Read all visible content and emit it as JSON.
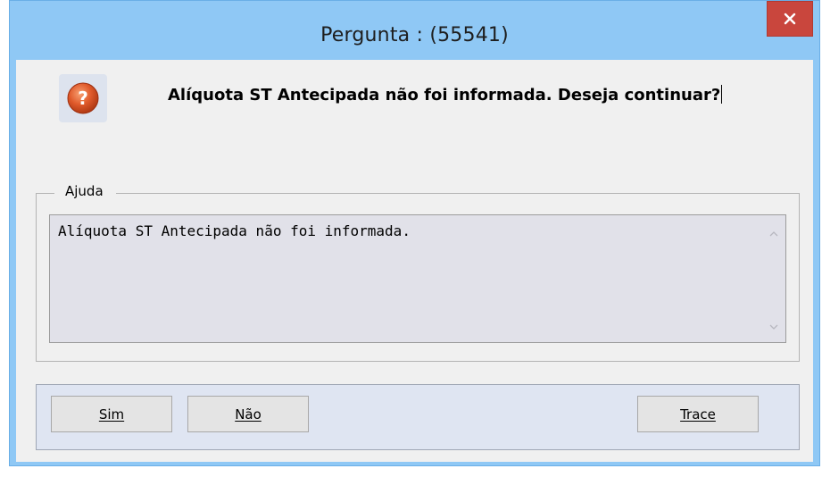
{
  "window": {
    "title": "Pergunta : (55541)"
  },
  "message": {
    "text": "Alíquota ST Antecipada não foi informada. Deseja continuar?"
  },
  "help": {
    "legend": "Ajuda",
    "text": "Alíquota ST Antecipada não foi informada."
  },
  "buttons": {
    "yes_label": "Sim",
    "no_label": "Não",
    "trace_label": "Trace"
  },
  "icons": {
    "close": "close-icon",
    "question": "question-icon",
    "scroll_up": "chevron-up-icon",
    "scroll_down": "chevron-down-icon"
  },
  "colors": {
    "titlebar": "#8fc8f5",
    "close_button": "#c9463d",
    "client_background": "#f0f0f0",
    "help_background": "#e1e1e9",
    "button_panel": "#dfe5f2",
    "question_icon": "#e05a2b"
  }
}
